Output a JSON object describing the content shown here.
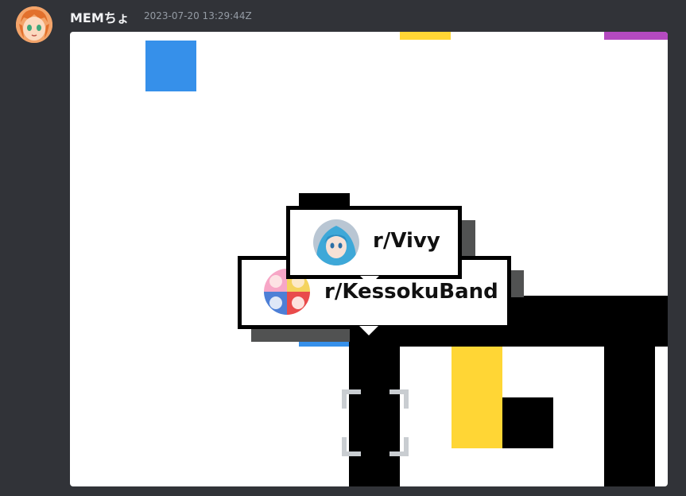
{
  "message": {
    "username": "MEMちょ",
    "timestamp": "2023-07-20 13:29:44Z",
    "avatar_icon": "user-avatar-icon"
  },
  "canvas": {
    "colors": {
      "blue": "#3690ea",
      "yellow": "#ffd635",
      "purple": "#b44ac0",
      "black": "#000000",
      "white": "#ffffff",
      "gray": "#515252"
    }
  },
  "tooltips": {
    "top": {
      "label": "r/Vivy",
      "icon": "vivy-subreddit-icon"
    },
    "bottom": {
      "label": "r/KessokuBand",
      "icon": "kessokuband-subreddit-icon"
    }
  }
}
